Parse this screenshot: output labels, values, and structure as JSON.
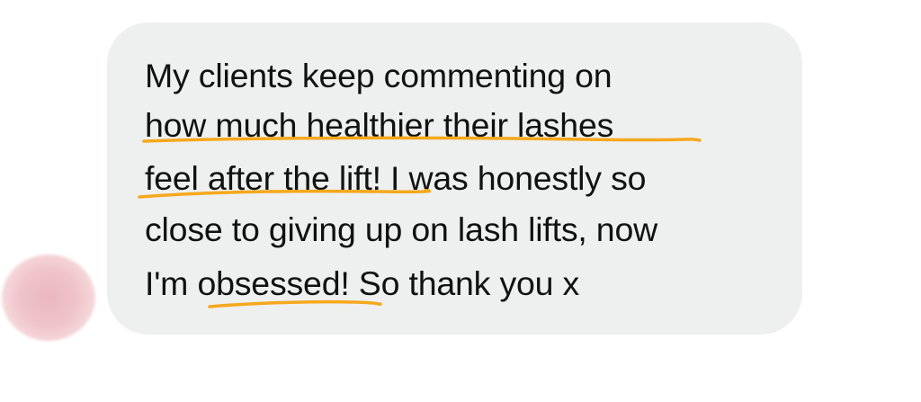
{
  "message": {
    "lines": [
      {
        "text": "My clients keep commenting on"
      },
      {
        "text": "how much healthier their lashes"
      },
      {
        "before": "",
        "highlight": "feel after the lift!",
        "after": " I was honestly so"
      },
      {
        "text": "close to giving up on lash lifts, now"
      },
      {
        "before": "I'm ",
        "highlight": "obsessed!",
        "after": " So thank you x"
      }
    ]
  },
  "colors": {
    "bubble": "#eeefef",
    "text": "#111111",
    "highlight_underline": "#f5a81c",
    "avatar": "#ebb9c0"
  }
}
